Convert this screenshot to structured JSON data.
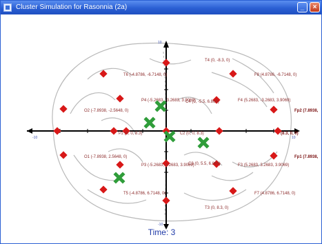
{
  "window": {
    "title": "Cluster Simulation for Rasonnia (2a)",
    "buttons": {
      "minimize": "_",
      "close": "×"
    }
  },
  "canvas": {
    "time_text": "Time: 3",
    "axis_ticks": {
      "x_left": "-10",
      "x_right": "10",
      "y_top": "10",
      "y_bottom": "-10"
    },
    "electrodes": [
      {
        "text": "T4 (0, -8.3, 0)"
      },
      {
        "text": "T6 (-4.8786, -6.7148, 0)"
      },
      {
        "text": "F8 (4.8786, -6.7148, 0)"
      },
      {
        "text": "P4 (-5.2683, -3.2683, 3.9069)"
      },
      {
        "text": "C4 (0, -5.5, 6.869)"
      },
      {
        "text": "F4 (5.2683, -3.2683, 3.9069)"
      },
      {
        "text": "O2 (-7.8938, -2.5648, 0)"
      },
      {
        "text": "Fp2 (7.8938,"
      },
      {
        "text": "Pz (0, 0, 8.3)"
      },
      {
        "text": "Cz (0, 0, 8.3)"
      },
      {
        "text": "(8.3, 0, 0)"
      },
      {
        "text": "Fp1 (7.8938,"
      },
      {
        "text": "O1 (-7.8938, 2.5648, 0)"
      },
      {
        "text": "P3 (-5.2683, 3.2683, 3.9069)"
      },
      {
        "text": "C3 (0, 5.5, 6.869)"
      },
      {
        "text": "F3 (5.2683, 3.2683, 3.9069)"
      },
      {
        "text": "T5 (-4.8786, 6.7148, 0)"
      },
      {
        "text": "F7 (4.8786, 6.7148, 0)"
      },
      {
        "text": "T3 (0, 8.3, 0)"
      }
    ]
  }
}
